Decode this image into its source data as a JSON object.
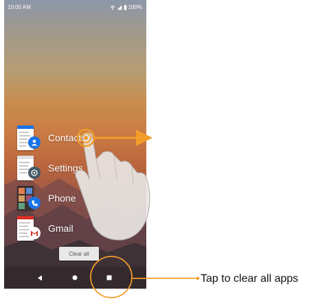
{
  "status_bar": {
    "time": "10:00 AM",
    "battery": "100%",
    "icons": [
      "wifi-icon",
      "signal-icon",
      "battery-icon"
    ]
  },
  "recent_apps": [
    {
      "label": "Contacts",
      "icon": "contacts-icon",
      "badge_color": "#1a73e8"
    },
    {
      "label": "Settings",
      "icon": "settings-icon",
      "badge_color": "#455a64"
    },
    {
      "label": "Phone",
      "icon": "phone-icon",
      "badge_color": "#1a73e8"
    },
    {
      "label": "Gmail",
      "icon": "gmail-icon",
      "badge_color": "#ffffff"
    }
  ],
  "clear_all": {
    "label": "Clear all"
  },
  "nav_bar": {
    "back": "back-icon",
    "home": "home-icon",
    "recents": "recents-icon"
  },
  "annotation": {
    "callout": "Tap to clear all apps",
    "accent_color": "#f39c2a",
    "gesture": "swipe-right"
  }
}
